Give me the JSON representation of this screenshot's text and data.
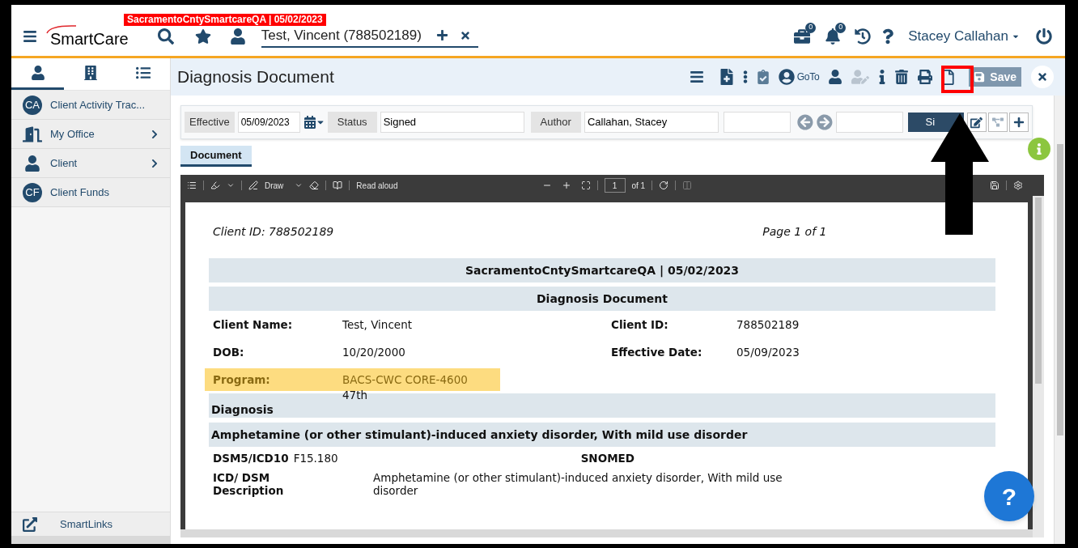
{
  "header": {
    "environment_banner": "SacramentoCntySmartcareQA | 05/02/2023",
    "logo": "SmartCare",
    "client_tab": "Test, Vincent (788502189)",
    "briefcase_badge": "0",
    "notification_badge": "0",
    "user": "Stacey Callahan"
  },
  "sidebar": {
    "tabs": [
      {
        "kind": "person",
        "selected": true
      },
      {
        "kind": "building",
        "selected": false
      },
      {
        "kind": "list",
        "selected": false
      }
    ],
    "items": [
      {
        "kind": "initials",
        "initials": "CA",
        "label": "Client Activity Trac...",
        "has_children": false
      },
      {
        "kind": "door",
        "label": "My Office",
        "has_children": true
      },
      {
        "kind": "person",
        "label": "Client",
        "has_children": true
      },
      {
        "kind": "initials",
        "initials": "CF",
        "label": "Client Funds",
        "has_children": false
      }
    ],
    "footer": "SmartLinks"
  },
  "page": {
    "title": "Diagnosis Document",
    "goto": "GoTo",
    "save": "Save"
  },
  "filter_bar": {
    "effective_label": "Effective",
    "effective_value": "05/09/2023",
    "status_label": "Status",
    "status_value": "Signed",
    "author_label": "Author",
    "author_value": "Callahan, Stacey",
    "sign_button": "Si"
  },
  "tabs": [
    {
      "label": "Document",
      "selected": true
    }
  ],
  "pdf_toolbar": {
    "draw": "Draw",
    "read_aloud": "Read aloud",
    "page": "1",
    "page_count": "of 1"
  },
  "document": {
    "client_id_header": "Client ID: 788502189",
    "page_label": "Page 1 of 1",
    "banner": "SacramentoCntySmartcareQA | 05/02/2023",
    "title": "Diagnosis Document",
    "fields": [
      {
        "label": "Client Name:",
        "value": "Test, Vincent",
        "right_label": "Client ID:",
        "right_value": "788502189",
        "highlighted": false
      },
      {
        "label": "DOB:",
        "value": "10/20/2000",
        "right_label": "Effective Date:",
        "right_value": "05/09/2023",
        "highlighted": false
      },
      {
        "label": "Program:",
        "value": "BACS-CWC CORE-4600",
        "highlighted": true
      }
    ],
    "program_overflow": "47th",
    "section": "Diagnosis",
    "diagnosis_title": "Amphetamine (or other stimulant)-induced anxiety disorder, With mild use disorder",
    "code_label": "DSM5/ICD10",
    "code_value": "F15.180",
    "snomed_label": "SNOMED",
    "description_label": "ICD/ DSM Description",
    "description_value": "Amphetamine (or other stimulant)-induced anxiety disorder, With mild use disorder"
  },
  "help_button": "?"
}
